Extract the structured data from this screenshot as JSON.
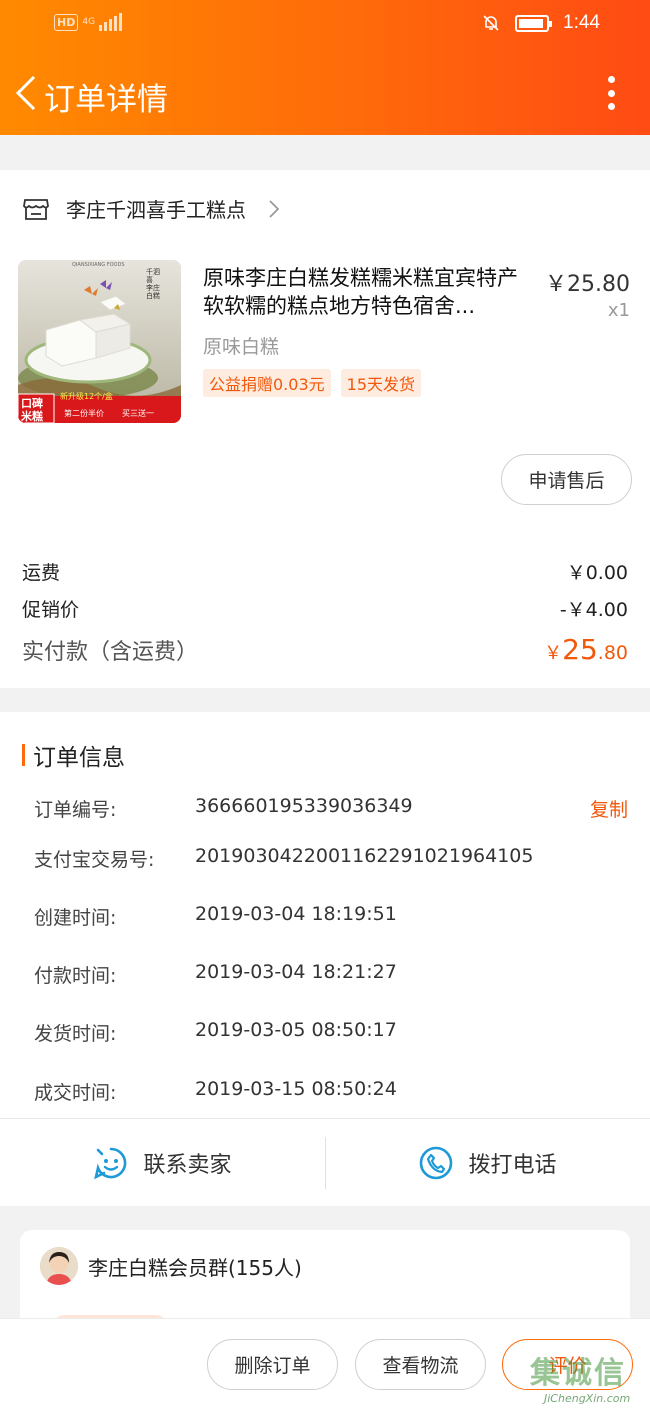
{
  "status_bar": {
    "hd": "HD",
    "network": "4G",
    "time": "1:44"
  },
  "nav": {
    "title": "订单详情"
  },
  "shop": {
    "name": "李庄千泗喜手工糕点"
  },
  "product": {
    "title": "原味李庄白糕发糕糯米糕宜宾特产软软糯的糕点地方特色宿舍...",
    "price": "￥25.80",
    "quantity": "x1",
    "sku": "原味白糕",
    "tags": [
      "公益捐赠0.03元",
      "15天发货"
    ],
    "image_text": {
      "side": "千泗喜 李庄白糕",
      "top": "QIANSIXIANG FOODS",
      "badge_line1": "口碑",
      "badge_line2": "米糕",
      "promo_1": "新升级12个/盒",
      "promo_2": "第二份半价",
      "promo_3": "买三送一"
    }
  },
  "after_sale_label": "申请售后",
  "fees": {
    "shipping_label": "运费",
    "shipping_value": "￥0.00",
    "promo_label": "促销价",
    "promo_value": "-￥4.00",
    "paid_label": "实付款（含运费）",
    "paid_currency": "￥",
    "paid_integer": "25",
    "paid_decimal": ".80"
  },
  "order_info": {
    "title": "订单信息",
    "copy_label": "复制",
    "rows": [
      {
        "label": "订单编号:",
        "value": "366660195339036349"
      },
      {
        "label": "支付宝交易号:",
        "value": "2019030422001162291021964105"
      },
      {
        "label": "创建时间:",
        "value": "2019-03-04 18:19:51"
      },
      {
        "label": "付款时间:",
        "value": "2019-03-04 18:21:27"
      },
      {
        "label": "发货时间:",
        "value": "2019-03-05 08:50:17"
      },
      {
        "label": "成交时间:",
        "value": "2019-03-15 08:50:24"
      }
    ]
  },
  "contact": {
    "seller_label": "联系卖家",
    "phone_label": "拨打电话"
  },
  "group": {
    "name": "李庄白糕会员群(155人)"
  },
  "bottom": {
    "delete_label": "删除订单",
    "logistics_label": "查看物流",
    "rate_label": "评价"
  },
  "watermark": {
    "top": "集诚信",
    "bottom": "JiChengXin.com"
  },
  "colors": {
    "accent": "#ff6a0a",
    "price_orange": "#f2580c",
    "contact_blue": "#1e9ad6"
  }
}
